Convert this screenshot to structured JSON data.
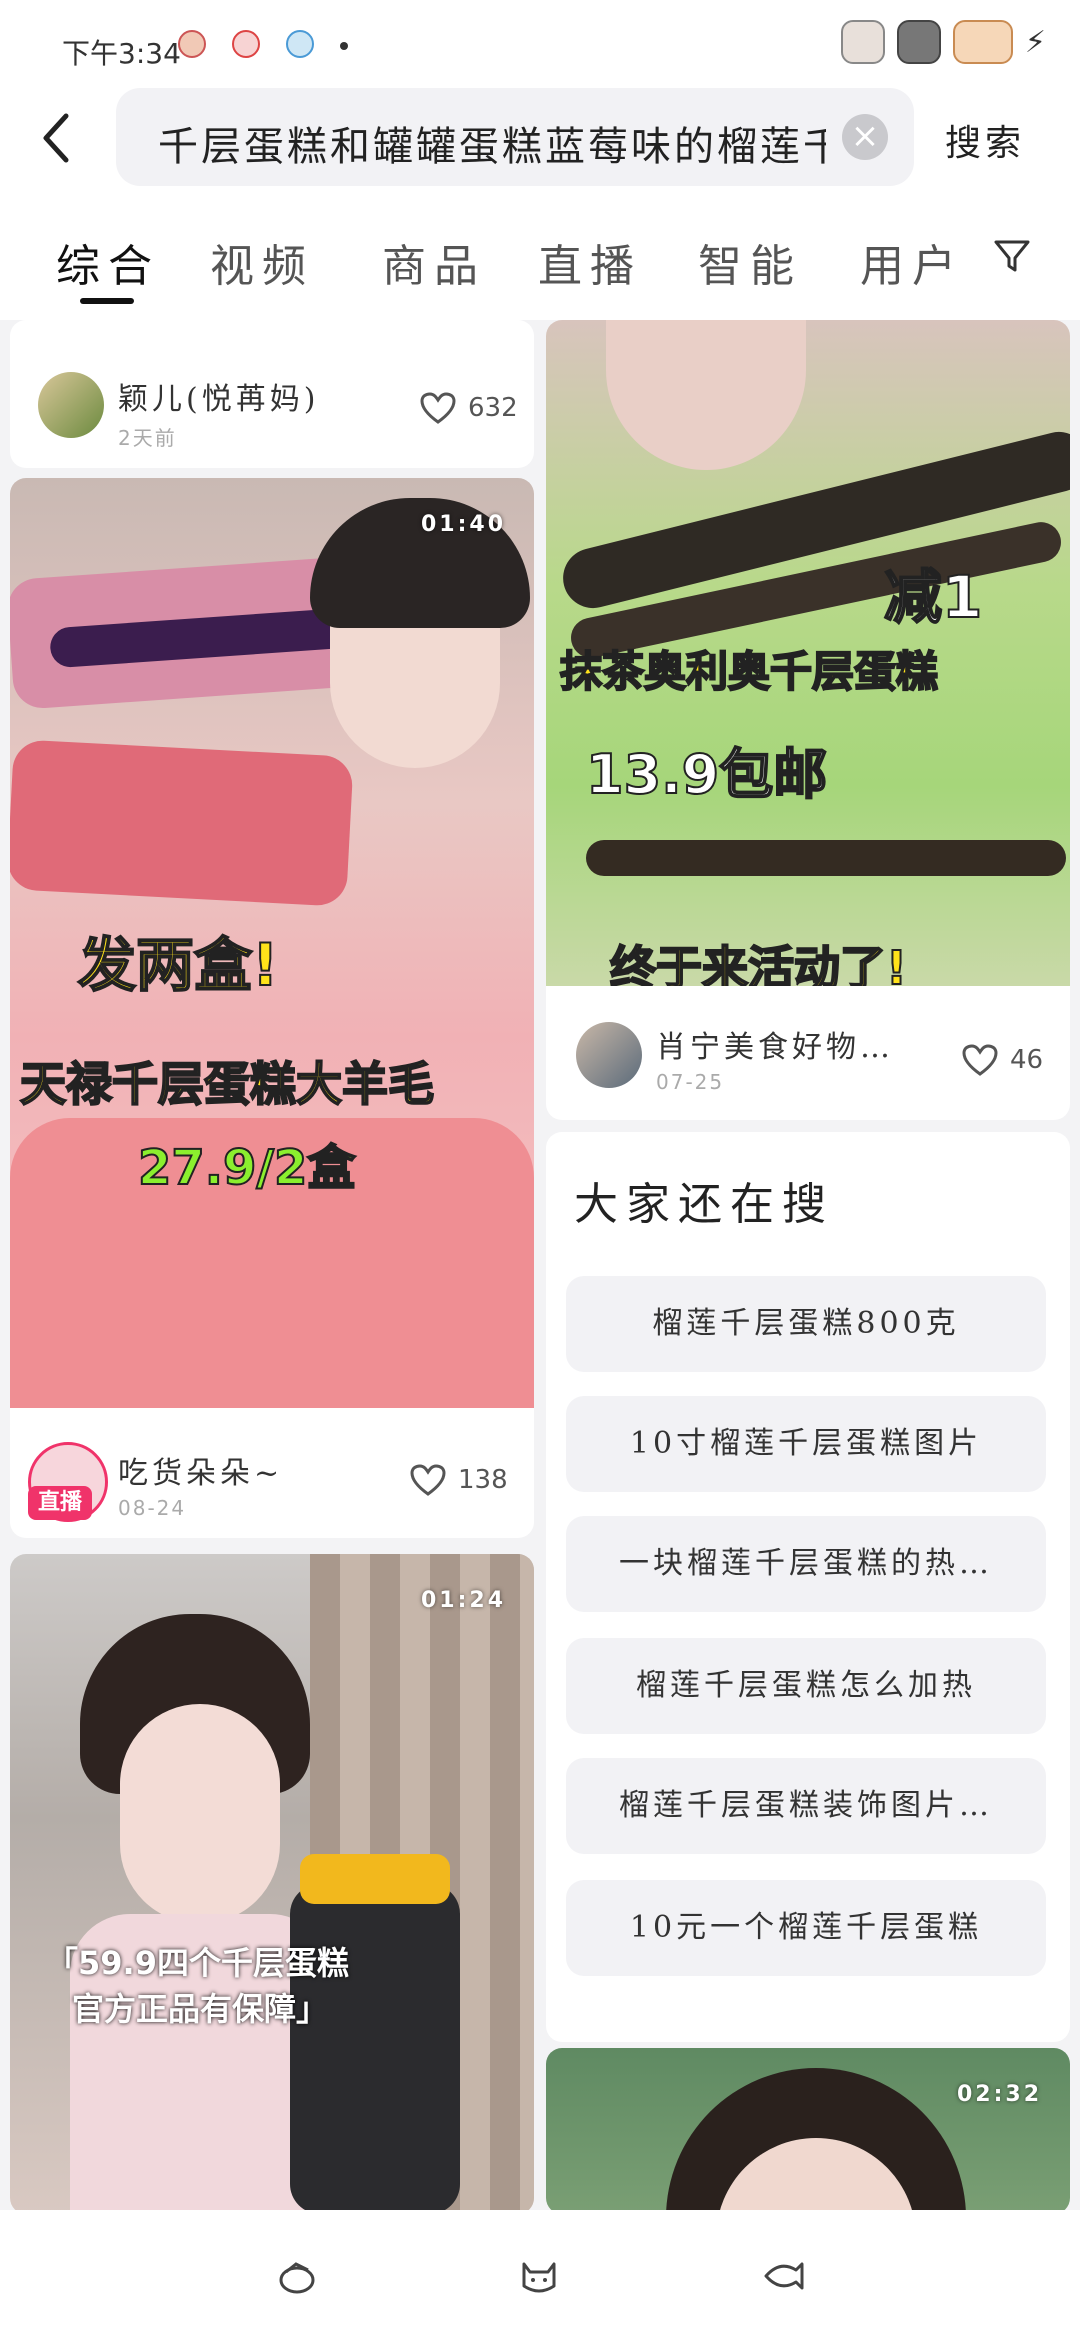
{
  "status": {
    "time": "下午3:34"
  },
  "search": {
    "query": "千层蛋糕和罐罐蛋糕蓝莓味的榴莲千层蛋糕",
    "button": "搜索"
  },
  "tabs": [
    "综合",
    "视频",
    "商品",
    "直播",
    "智能",
    "用户"
  ],
  "cards": {
    "top_left": {
      "author": "颖儿(悦苒妈)",
      "date": "2天前",
      "likes": "632"
    },
    "left_1": {
      "duration": "01:40",
      "overlay": [
        "发两盒!",
        "天禄千层蛋糕大羊毛",
        "27.9/2盒"
      ],
      "author": "吃货朵朵~",
      "date": "08-24",
      "likes": "138",
      "badge": "直播"
    },
    "right_1": {
      "overlay": [
        "减1",
        "抹茶奥利奥千层蛋糕",
        "13.9包邮",
        "终于来活动了!"
      ],
      "author": "肖宁美食好物…",
      "date": "07-25",
      "likes": "46"
    },
    "left_2": {
      "duration": "01:24",
      "overlay": [
        "「59.9四个千层蛋糕",
        "官方正品有保障」"
      ]
    },
    "right_2": {
      "duration": "02:32"
    }
  },
  "also_searched": {
    "title": "大家还在搜",
    "items": [
      "榴莲千层蛋糕800克",
      "10寸榴莲千层蛋糕图片",
      "一块榴莲千层蛋糕的热…",
      "榴莲千层蛋糕怎么加热",
      "榴莲千层蛋糕装饰图片…",
      "10元一个榴莲千层蛋糕"
    ]
  },
  "icons": {
    "back": "back-arrow-icon",
    "clear": "clear-icon",
    "filter": "filter-icon",
    "like": "heart-icon"
  },
  "colors": {
    "accent": "#f0336a",
    "text": "#222222",
    "bg": "#f3f3f5"
  }
}
